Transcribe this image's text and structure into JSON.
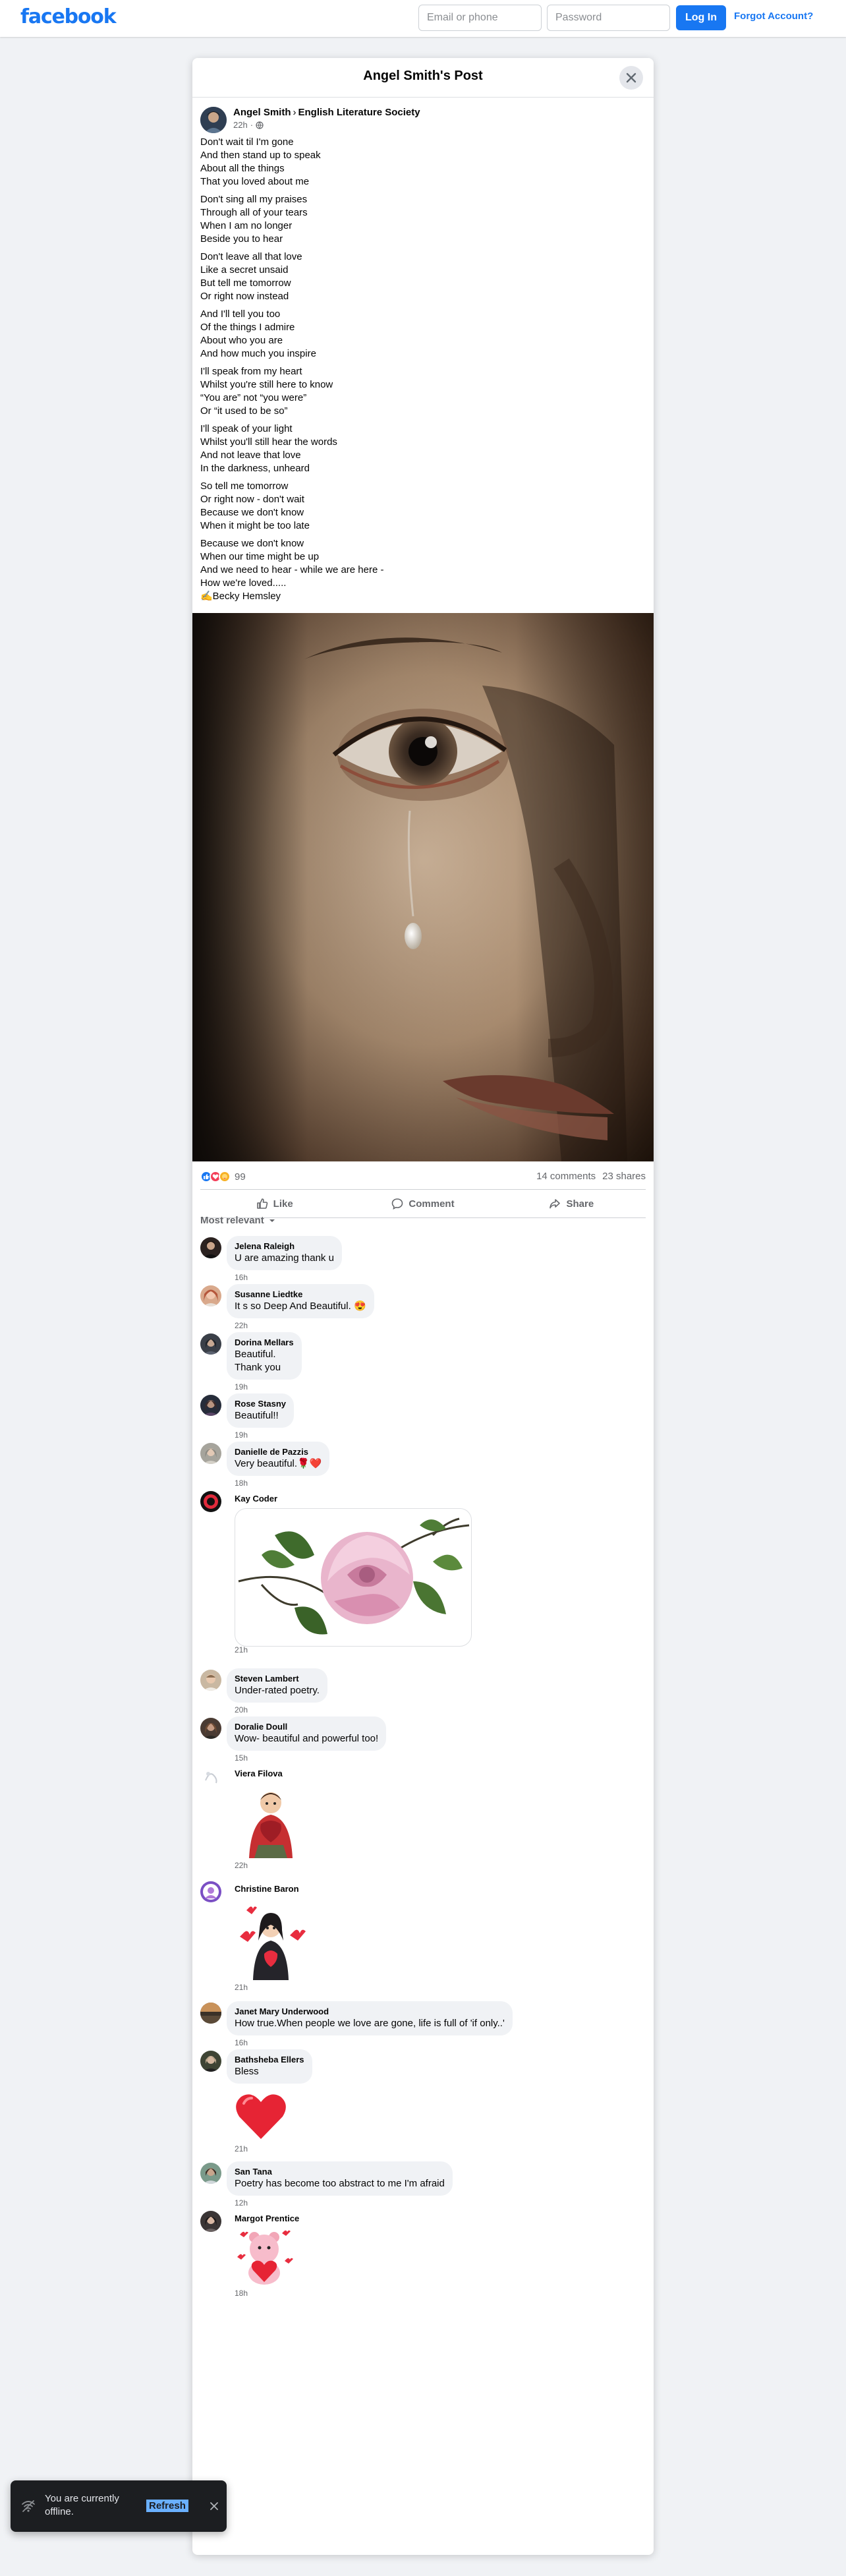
{
  "topbar": {
    "logo": "facebook",
    "email_placeholder": "Email or phone",
    "password_placeholder": "Password",
    "login_label": "Log In",
    "forgot_label": "Forgot Account?"
  },
  "post": {
    "title": "Angel Smith's Post",
    "author": "Angel Smith",
    "group": "English Literature Society",
    "time": "22h",
    "privacy_icon": "globe-icon",
    "stanzas": [
      [
        "Don't wait til I'm gone",
        "And then stand up to speak",
        "About all the things",
        "That you loved about me"
      ],
      [
        "Don't sing all my praises",
        "Through all of your tears",
        "When I am no longer",
        "Beside you to hear"
      ],
      [
        "Don't leave all that love",
        "Like a secret unsaid",
        "But tell me tomorrow",
        "Or right now instead"
      ],
      [
        "And I'll tell you too",
        "Of the things I admire",
        "About who you are",
        "And how much you inspire"
      ],
      [
        "I'll speak from my heart",
        "Whilst you're still here to know",
        "“You are” not “you were”",
        "Or “it used to be so”"
      ],
      [
        "I'll speak of your light",
        "Whilst you'll still hear the words",
        "And not leave that love",
        "In the darkness, unheard"
      ],
      [
        "So tell me tomorrow",
        "Or right now - don't wait",
        "Because we don't know",
        "When it might be too late"
      ],
      [
        "Because we don't know",
        "When our time might be up",
        "And we need to hear - while we are here -",
        "How we're loved.....",
        "✍️Becky Hemsley"
      ]
    ],
    "reaction_count": "99",
    "comments_count": "14 comments",
    "shares_count": "23 shares",
    "actions": {
      "like": "Like",
      "comment": "Comment",
      "share": "Share"
    },
    "sort_label": "Most relevant"
  },
  "comments": [
    {
      "name": "Jelena Raleigh",
      "text": "U are amazing thank u",
      "time": "16h"
    },
    {
      "name": "Susanne Liedtke",
      "text": "It s so Deep And Beautiful. 😍",
      "time": "22h"
    },
    {
      "name": "Dorina Mellars",
      "text": "Beautiful.",
      "text2": "Thank you",
      "time": "19h"
    },
    {
      "name": "Rose Stasny",
      "text": "Beautiful!!",
      "time": "19h"
    },
    {
      "name": "Danielle de Pazzis",
      "text": "Very beautiful.🌹❤️",
      "time": "18h"
    },
    {
      "name": "Kay Coder",
      "text": "",
      "time": "21h",
      "attachment": "pink-rose-image"
    },
    {
      "name": "Steven Lambert",
      "text": "Under-rated poetry.",
      "time": "20h"
    },
    {
      "name": "Doralie Doull",
      "text": "Wow- beautiful and powerful too!",
      "time": "15h"
    },
    {
      "name": "Viera Filova",
      "text": "",
      "time": "22h",
      "attachment": "heart-hug-sticker"
    },
    {
      "name": "Christine Baron",
      "text": "",
      "time": "21h",
      "attachment": "hearts-sticker"
    },
    {
      "name": "Janet Mary Underwood",
      "text": "How true.When people we love are gone, life is full of 'if only..'",
      "time": "16h"
    },
    {
      "name": "Bathsheba Ellers",
      "text": "Bless",
      "time": "21h",
      "attachment": "red-heart-sticker"
    },
    {
      "name": "San Tana",
      "text": "Poetry has become too abstract to me I'm afraid",
      "time": "12h"
    },
    {
      "name": "Margot Prentice",
      "text": "",
      "time": "18h",
      "attachment": "love-bear-sticker"
    }
  ],
  "toast": {
    "message": "You are currently offline.",
    "action": "Refresh"
  },
  "colors": {
    "brand": "#1877f2",
    "page_bg": "#f0f2f5",
    "bubble_bg": "#f0f2f5",
    "muted_text": "#65676b"
  }
}
